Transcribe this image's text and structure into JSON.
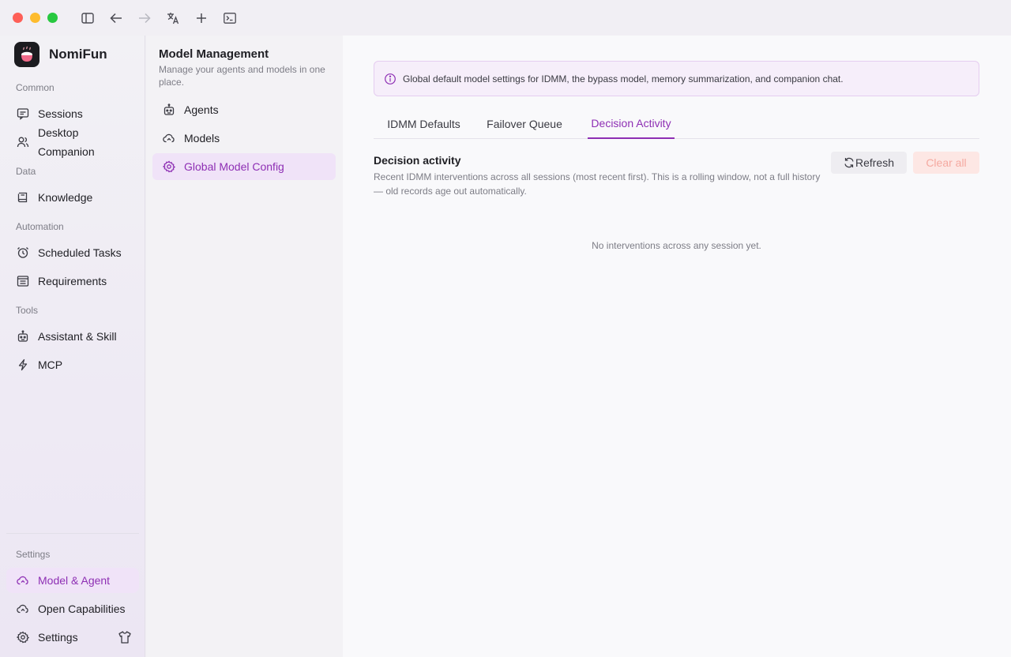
{
  "titlebar": {
    "icons": [
      "sidebar-toggle-icon",
      "back-arrow-icon",
      "forward-arrow-icon",
      "translate-icon",
      "plus-icon",
      "terminal-icon"
    ]
  },
  "brand": {
    "name": "NomiFun"
  },
  "sidebar": {
    "sections": {
      "common": "Common",
      "data": "Data",
      "automation": "Automation",
      "tools": "Tools",
      "settings": "Settings"
    },
    "items": {
      "sessions": "Sessions",
      "desktop_companion": "Desktop Companion",
      "knowledge": "Knowledge",
      "scheduled_tasks": "Scheduled Tasks",
      "requirements": "Requirements",
      "assistant_skill": "Assistant & Skill",
      "mcp": "MCP",
      "model_agent": "Model & Agent",
      "open_capabilities": "Open Capabilities",
      "settings": "Settings"
    }
  },
  "midpanel": {
    "title": "Model Management",
    "subtitle": "Manage your agents and models in one place.",
    "items": {
      "agents": "Agents",
      "models": "Models",
      "global_model_config": "Global Model Config"
    }
  },
  "main": {
    "banner": "Global default model settings for IDMM, the bypass model, memory summarization, and companion chat.",
    "tabs": {
      "idmm_defaults": "IDMM Defaults",
      "failover_queue": "Failover Queue",
      "decision_activity": "Decision Activity"
    },
    "active_tab": "Decision Activity",
    "section_title": "Decision activity",
    "section_desc": "Recent IDMM interventions across all sessions (most recent first). This is a rolling window, not a full history — old records age out automatically.",
    "refresh_label": "Refresh",
    "clear_all_label": "Clear all",
    "empty_text": "No interventions across any session yet."
  },
  "colors": {
    "accent": "#8e2fb4",
    "active_bg": "#f0e3f8",
    "danger_text": "#f5a9a0",
    "danger_bg": "#fde7e4"
  }
}
